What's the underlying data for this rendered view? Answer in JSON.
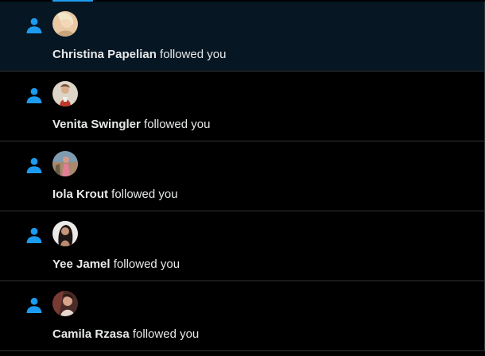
{
  "colors": {
    "accent": "#1d9bf0",
    "background": "#000000",
    "unread_background": "#061623",
    "divider": "#2f3336",
    "text": "#e7e9ea"
  },
  "notifications": [
    {
      "type_icon": "person-icon",
      "name": "Christina Papelian",
      "action": " followed you",
      "unread": true
    },
    {
      "type_icon": "person-icon",
      "name": "Venita Swingler",
      "action": " followed you",
      "unread": false
    },
    {
      "type_icon": "person-icon",
      "name": "Iola Krout",
      "action": " followed you",
      "unread": false
    },
    {
      "type_icon": "person-icon",
      "name": "Yee Jamel",
      "action": " followed you",
      "unread": false
    },
    {
      "type_icon": "person-icon",
      "name": "Camila Rzasa",
      "action": " followed you",
      "unread": false
    }
  ]
}
